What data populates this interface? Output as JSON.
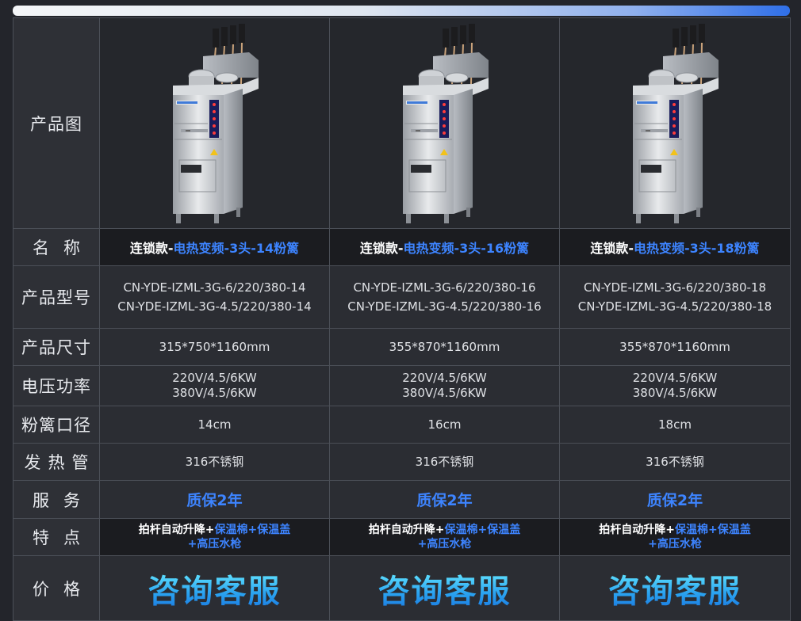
{
  "labels": {
    "image": "产品图",
    "name": "名称",
    "model": "产品型号",
    "size": "产品尺寸",
    "power": "电压功率",
    "basket": "粉篱口径",
    "heater": "发热管",
    "service": "服务",
    "features": "特点",
    "price": "价格"
  },
  "products": [
    {
      "name_prefix": "连锁款-",
      "name_main": "电热变频-3头-14粉篱",
      "model_1": "CN-YDE-IZML-3G-6/220/380-14",
      "model_2": "CN-YDE-IZML-3G-4.5/220/380-14",
      "size": "315*750*1160mm",
      "power_1": "220V/4.5/6KW",
      "power_2": "380V/4.5/6KW",
      "basket": "14cm",
      "heater": "316不锈钢",
      "service": "质保2年",
      "feature_a": "拍杆自动升降+",
      "feature_b": "保温棉+保温盖",
      "feature_c": "+高压水枪",
      "price": "咨询客服"
    },
    {
      "name_prefix": "连锁款-",
      "name_main": "电热变频-3头-16粉篱",
      "model_1": "CN-YDE-IZML-3G-6/220/380-16",
      "model_2": "CN-YDE-IZML-3G-4.5/220/380-16",
      "size": "355*870*1160mm",
      "power_1": "220V/4.5/6KW",
      "power_2": "380V/4.5/6KW",
      "basket": "16cm",
      "heater": "316不锈钢",
      "service": "质保2年",
      "feature_a": "拍杆自动升降+",
      "feature_b": "保温棉+保温盖",
      "feature_c": "+高压水枪",
      "price": "咨询客服"
    },
    {
      "name_prefix": "连锁款-",
      "name_main": "电热变频-3头-18粉篱",
      "model_1": "CN-YDE-IZML-3G-6/220/380-18",
      "model_2": "CN-YDE-IZML-3G-4.5/220/380-18",
      "size": "355*870*1160mm",
      "power_1": "220V/4.5/6KW",
      "power_2": "380V/4.5/6KW",
      "basket": "18cm",
      "heater": "316不锈钢",
      "service": "质保2年",
      "feature_a": "拍杆自动升降+",
      "feature_b": "保温棉+保温盖",
      "feature_c": "+高压水枪",
      "price": "咨询客服"
    }
  ],
  "colors": {
    "accent_blue": "#3d84ff",
    "price_gradient_top": "#5ee0ff",
    "price_gradient_bottom": "#1a78e0"
  }
}
